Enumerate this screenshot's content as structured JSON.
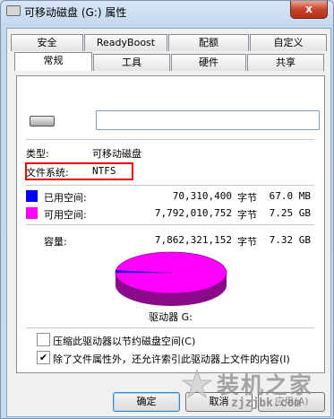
{
  "window": {
    "title": "可移动磁盘 (G:) 属性",
    "close_glyph": "x"
  },
  "tabs": [
    {
      "label": "安全"
    },
    {
      "label": "ReadyBoost"
    },
    {
      "label": "配额"
    },
    {
      "label": "自定义"
    },
    {
      "label": "常规"
    },
    {
      "label": "工具"
    },
    {
      "label": "硬件"
    },
    {
      "label": "共享"
    }
  ],
  "general": {
    "drive_name_value": "",
    "type_label": "类型:",
    "type_value": "可移动磁盘",
    "fs_label": "文件系统:",
    "fs_value": "NTFS",
    "used": {
      "label": "已用空间:",
      "bytes": "70,310,400",
      "unit": "字节",
      "size": "67.0 MB",
      "color": "#0000ff"
    },
    "free": {
      "label": "可用空间:",
      "bytes": "7,792,010,752",
      "unit": "字节",
      "size": "7.25 GB",
      "color": "#ff00ff"
    },
    "capacity": {
      "label": "容量:",
      "bytes": "7,862,321,152",
      "unit": "字节",
      "size": "7.32 GB"
    },
    "drive_label": "驱动器 G:",
    "compress_label": "压缩此驱动器以节约磁盘空间(C)",
    "compress_checked": false,
    "index_label": "除了文件属性外，还允许索引此驱动器上文件的内容(I)",
    "index_checked": true
  },
  "buttons": {
    "ok": "确定",
    "cancel": "取消",
    "apply": "应用(A)"
  },
  "watermark": {
    "text": "装机之家",
    "url": "zjzjbk.com"
  }
}
